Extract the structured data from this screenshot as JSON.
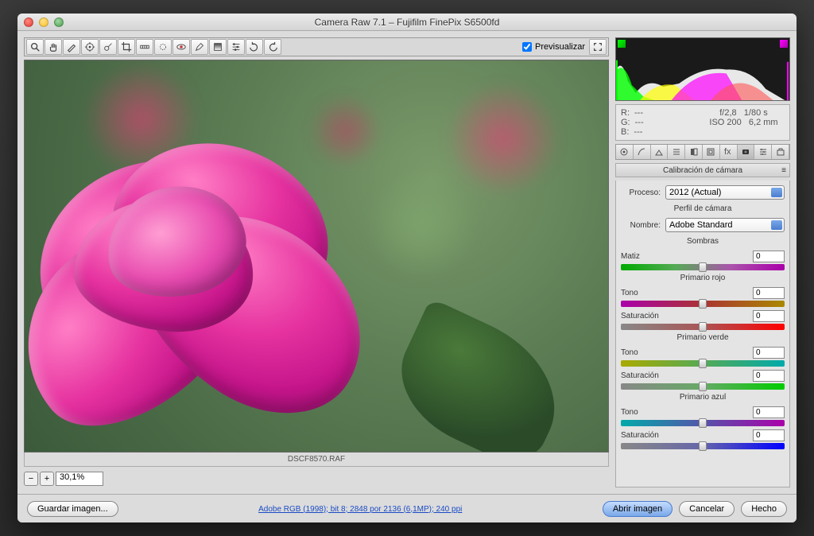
{
  "window": {
    "title": "Camera Raw 7.1  –  Fujifilm FinePix S6500fd"
  },
  "preview": {
    "label": "Previsualizar",
    "checked": true
  },
  "filename": "DSCF8570.RAF",
  "zoom": {
    "value": "30,1%"
  },
  "info": {
    "r": "R:",
    "g": "G:",
    "b": "B:",
    "rv": "---",
    "gv": "---",
    "bv": "---",
    "aperture": "f/2,8",
    "shutter": "1/80 s",
    "iso": "ISO 200",
    "focal": "6,2 mm"
  },
  "panel": {
    "title": "Calibración de cámara",
    "proceso_label": "Proceso:",
    "proceso_value": "2012 (Actual)",
    "perfil_header": "Perfil de cámara",
    "nombre_label": "Nombre:",
    "nombre_value": "Adobe Standard",
    "sombras_header": "Sombras",
    "matiz_label": "Matiz",
    "matiz_value": "0",
    "rojo_header": "Primario rojo",
    "verde_header": "Primario verde",
    "azul_header": "Primario azul",
    "tono_label": "Tono",
    "tono_value": "0",
    "sat_label": "Saturación",
    "sat_value": "0"
  },
  "footer": {
    "guardar": "Guardar imagen...",
    "link": "Adobe RGB (1998); bit 8; 2848 por 2136 (6,1MP); 240 ppi",
    "abrir": "Abrir imagen",
    "cancelar": "Cancelar",
    "hecho": "Hecho"
  }
}
